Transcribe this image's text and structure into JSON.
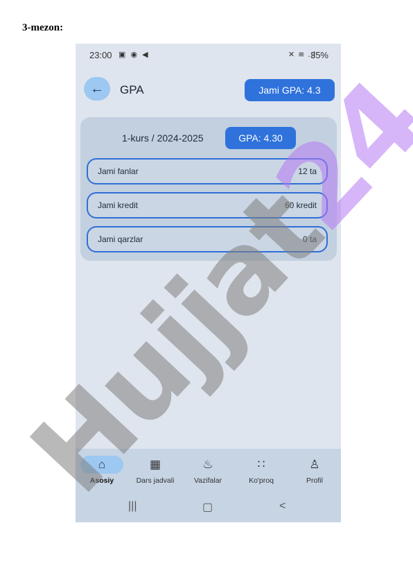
{
  "document": {
    "heading": "3-mezon:"
  },
  "status_bar": {
    "time": "23:00",
    "left_icons": "▣ ◉ ◀",
    "right_icons": "✕ ≋ .ıl",
    "battery": "35%"
  },
  "header": {
    "back_icon": "arrow-left-icon",
    "title": "GPA",
    "total_gpa": "Jami GPA: 4.3"
  },
  "card": {
    "year": "1-kurs / 2024-2025",
    "gpa": "GPA: 4.30",
    "rows": [
      {
        "label": "Jami fanlar",
        "value": "12 ta"
      },
      {
        "label": "Jami kredit",
        "value": "60 kredit"
      },
      {
        "label": "Jami qarzlar",
        "value": "0 ta"
      }
    ]
  },
  "nav": {
    "items": [
      {
        "label": "Asosiy",
        "icon": "home-icon",
        "active": true
      },
      {
        "label": "Dars jadvali",
        "icon": "calendar-icon",
        "active": false
      },
      {
        "label": "Vazifalar",
        "icon": "fire-icon",
        "active": false
      },
      {
        "label": "Ko'proq",
        "icon": "grid-icon",
        "active": false
      },
      {
        "label": "Profil",
        "icon": "user-icon",
        "active": false
      }
    ]
  },
  "system_nav": {
    "recents": "|||",
    "home": "▢",
    "back": "<"
  },
  "watermark": {
    "text": "Hujjat24",
    "colors": {
      "gray": "#808080",
      "violet": "#b478f2"
    }
  },
  "colors": {
    "accent": "#2f72dc",
    "accent_light": "#9cc8f2",
    "background": "#dfe5ee",
    "card": "#c3d0e0"
  }
}
